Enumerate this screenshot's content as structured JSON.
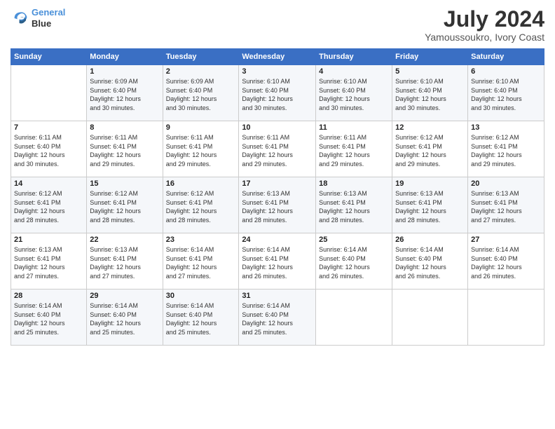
{
  "logo": {
    "line1": "General",
    "line2": "Blue"
  },
  "title": "July 2024",
  "subtitle": "Yamoussoukro, Ivory Coast",
  "header_days": [
    "Sunday",
    "Monday",
    "Tuesday",
    "Wednesday",
    "Thursday",
    "Friday",
    "Saturday"
  ],
  "weeks": [
    [
      {
        "day": "",
        "info": ""
      },
      {
        "day": "1",
        "info": "Sunrise: 6:09 AM\nSunset: 6:40 PM\nDaylight: 12 hours\nand 30 minutes."
      },
      {
        "day": "2",
        "info": "Sunrise: 6:09 AM\nSunset: 6:40 PM\nDaylight: 12 hours\nand 30 minutes."
      },
      {
        "day": "3",
        "info": "Sunrise: 6:10 AM\nSunset: 6:40 PM\nDaylight: 12 hours\nand 30 minutes."
      },
      {
        "day": "4",
        "info": "Sunrise: 6:10 AM\nSunset: 6:40 PM\nDaylight: 12 hours\nand 30 minutes."
      },
      {
        "day": "5",
        "info": "Sunrise: 6:10 AM\nSunset: 6:40 PM\nDaylight: 12 hours\nand 30 minutes."
      },
      {
        "day": "6",
        "info": "Sunrise: 6:10 AM\nSunset: 6:40 PM\nDaylight: 12 hours\nand 30 minutes."
      }
    ],
    [
      {
        "day": "7",
        "info": "Sunrise: 6:11 AM\nSunset: 6:40 PM\nDaylight: 12 hours\nand 30 minutes."
      },
      {
        "day": "8",
        "info": "Sunrise: 6:11 AM\nSunset: 6:41 PM\nDaylight: 12 hours\nand 29 minutes."
      },
      {
        "day": "9",
        "info": "Sunrise: 6:11 AM\nSunset: 6:41 PM\nDaylight: 12 hours\nand 29 minutes."
      },
      {
        "day": "10",
        "info": "Sunrise: 6:11 AM\nSunset: 6:41 PM\nDaylight: 12 hours\nand 29 minutes."
      },
      {
        "day": "11",
        "info": "Sunrise: 6:11 AM\nSunset: 6:41 PM\nDaylight: 12 hours\nand 29 minutes."
      },
      {
        "day": "12",
        "info": "Sunrise: 6:12 AM\nSunset: 6:41 PM\nDaylight: 12 hours\nand 29 minutes."
      },
      {
        "day": "13",
        "info": "Sunrise: 6:12 AM\nSunset: 6:41 PM\nDaylight: 12 hours\nand 29 minutes."
      }
    ],
    [
      {
        "day": "14",
        "info": "Sunrise: 6:12 AM\nSunset: 6:41 PM\nDaylight: 12 hours\nand 28 minutes."
      },
      {
        "day": "15",
        "info": "Sunrise: 6:12 AM\nSunset: 6:41 PM\nDaylight: 12 hours\nand 28 minutes."
      },
      {
        "day": "16",
        "info": "Sunrise: 6:12 AM\nSunset: 6:41 PM\nDaylight: 12 hours\nand 28 minutes."
      },
      {
        "day": "17",
        "info": "Sunrise: 6:13 AM\nSunset: 6:41 PM\nDaylight: 12 hours\nand 28 minutes."
      },
      {
        "day": "18",
        "info": "Sunrise: 6:13 AM\nSunset: 6:41 PM\nDaylight: 12 hours\nand 28 minutes."
      },
      {
        "day": "19",
        "info": "Sunrise: 6:13 AM\nSunset: 6:41 PM\nDaylight: 12 hours\nand 28 minutes."
      },
      {
        "day": "20",
        "info": "Sunrise: 6:13 AM\nSunset: 6:41 PM\nDaylight: 12 hours\nand 27 minutes."
      }
    ],
    [
      {
        "day": "21",
        "info": "Sunrise: 6:13 AM\nSunset: 6:41 PM\nDaylight: 12 hours\nand 27 minutes."
      },
      {
        "day": "22",
        "info": "Sunrise: 6:13 AM\nSunset: 6:41 PM\nDaylight: 12 hours\nand 27 minutes."
      },
      {
        "day": "23",
        "info": "Sunrise: 6:14 AM\nSunset: 6:41 PM\nDaylight: 12 hours\nand 27 minutes."
      },
      {
        "day": "24",
        "info": "Sunrise: 6:14 AM\nSunset: 6:41 PM\nDaylight: 12 hours\nand 26 minutes."
      },
      {
        "day": "25",
        "info": "Sunrise: 6:14 AM\nSunset: 6:40 PM\nDaylight: 12 hours\nand 26 minutes."
      },
      {
        "day": "26",
        "info": "Sunrise: 6:14 AM\nSunset: 6:40 PM\nDaylight: 12 hours\nand 26 minutes."
      },
      {
        "day": "27",
        "info": "Sunrise: 6:14 AM\nSunset: 6:40 PM\nDaylight: 12 hours\nand 26 minutes."
      }
    ],
    [
      {
        "day": "28",
        "info": "Sunrise: 6:14 AM\nSunset: 6:40 PM\nDaylight: 12 hours\nand 25 minutes."
      },
      {
        "day": "29",
        "info": "Sunrise: 6:14 AM\nSunset: 6:40 PM\nDaylight: 12 hours\nand 25 minutes."
      },
      {
        "day": "30",
        "info": "Sunrise: 6:14 AM\nSunset: 6:40 PM\nDaylight: 12 hours\nand 25 minutes."
      },
      {
        "day": "31",
        "info": "Sunrise: 6:14 AM\nSunset: 6:40 PM\nDaylight: 12 hours\nand 25 minutes."
      },
      {
        "day": "",
        "info": ""
      },
      {
        "day": "",
        "info": ""
      },
      {
        "day": "",
        "info": ""
      }
    ]
  ]
}
